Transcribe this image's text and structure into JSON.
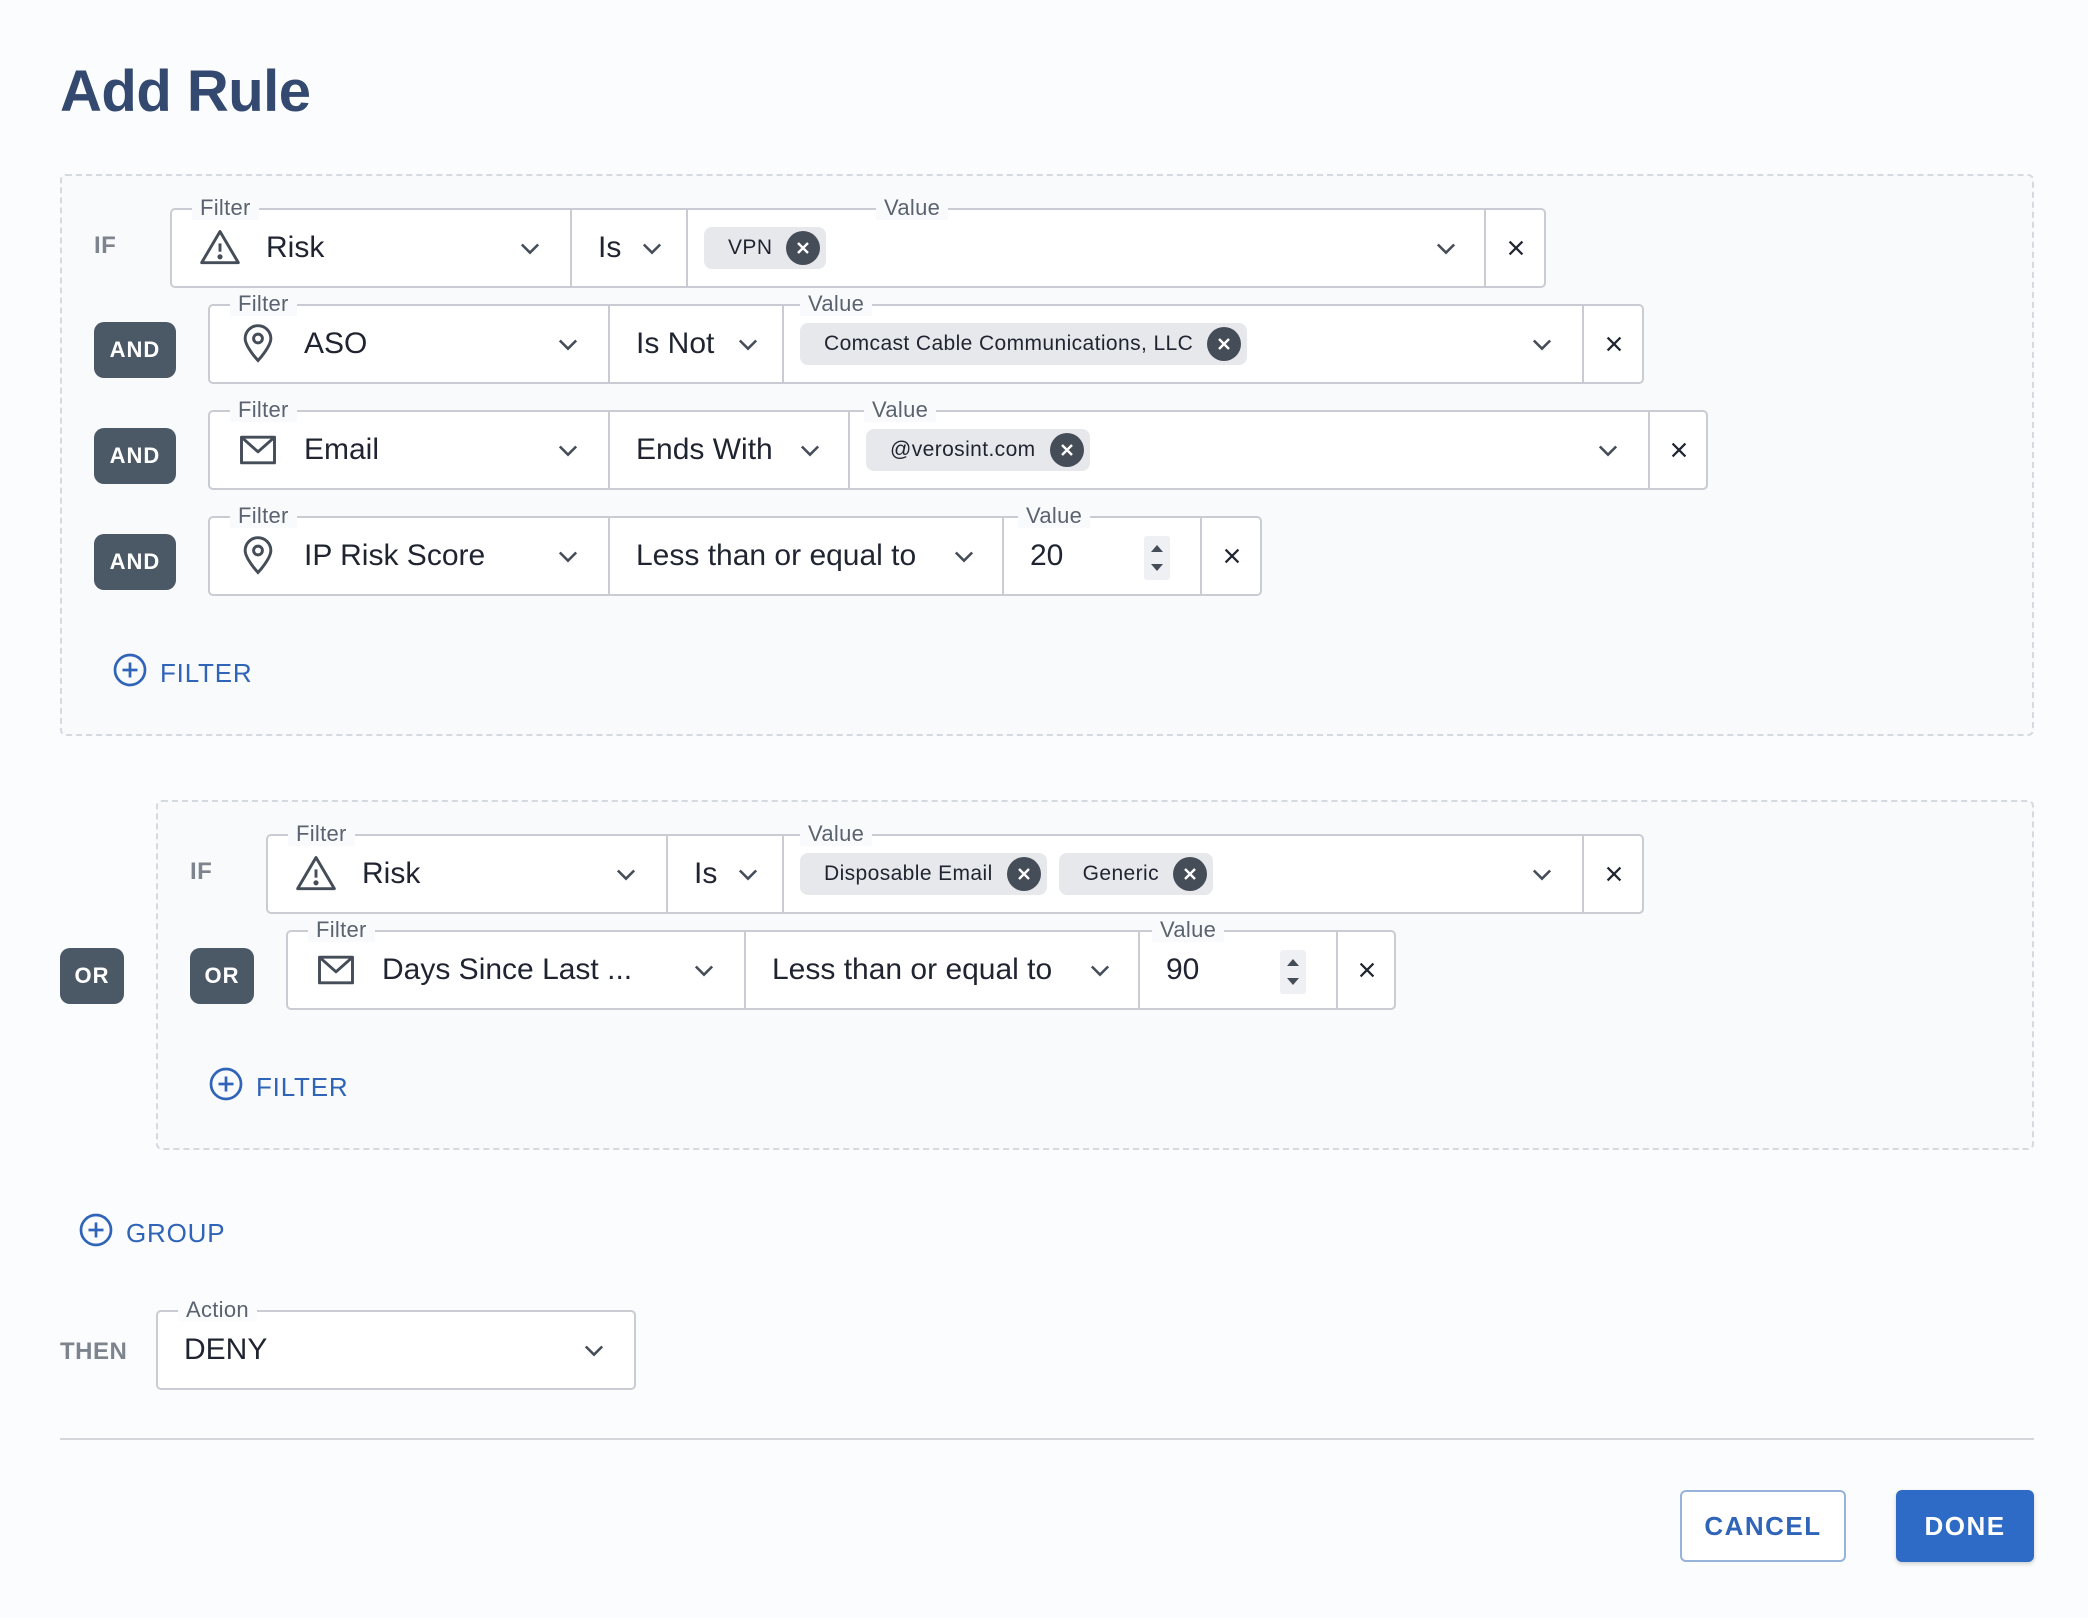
{
  "dialog": {
    "title": "Add Rule"
  },
  "group1": {
    "if_label": "IF",
    "rows": [
      {
        "connector": "",
        "filter_legend": "Filter",
        "filter": "Risk",
        "filter_icon": "warning-triangle-icon",
        "operator": "Is",
        "value_legend": "Value",
        "chips": [
          "VPN"
        ]
      },
      {
        "connector": "AND",
        "filter_legend": "Filter",
        "filter": "ASO",
        "filter_icon": "map-pin-icon",
        "operator": "Is Not",
        "value_legend": "Value",
        "chips": [
          "Comcast Cable Communications, LLC"
        ]
      },
      {
        "connector": "AND",
        "filter_legend": "Filter",
        "filter": "Email",
        "filter_icon": "envelope-icon",
        "operator": "Ends With",
        "value_legend": "Value",
        "chips": [
          "@verosint.com"
        ]
      },
      {
        "connector": "AND",
        "filter_legend": "Filter",
        "filter": "IP Risk Score",
        "filter_icon": "map-pin-icon",
        "operator": "Less than or equal to",
        "value_legend": "Value",
        "number": "20"
      }
    ],
    "add_filter": "FILTER"
  },
  "group_connector": "OR",
  "group2": {
    "if_label": "IF",
    "rows": [
      {
        "connector": "",
        "filter_legend": "Filter",
        "filter": "Risk",
        "filter_icon": "warning-triangle-icon",
        "operator": "Is",
        "value_legend": "Value",
        "chips": [
          "Disposable Email",
          "Generic"
        ]
      },
      {
        "connector": "OR",
        "filter_legend": "Filter",
        "filter": "Days Since Last ...",
        "filter_icon": "envelope-icon",
        "operator": "Less than or equal to",
        "value_legend": "Value",
        "number": "90"
      }
    ],
    "add_filter": "FILTER"
  },
  "add_group": "GROUP",
  "then": {
    "label": "THEN",
    "legend": "Action",
    "value": "DENY"
  },
  "footer": {
    "cancel": "CANCEL",
    "done": "DONE"
  },
  "colors": {
    "title": "#34496f",
    "accent": "#2e6bc6",
    "chip_keyword": "#4b5866"
  }
}
